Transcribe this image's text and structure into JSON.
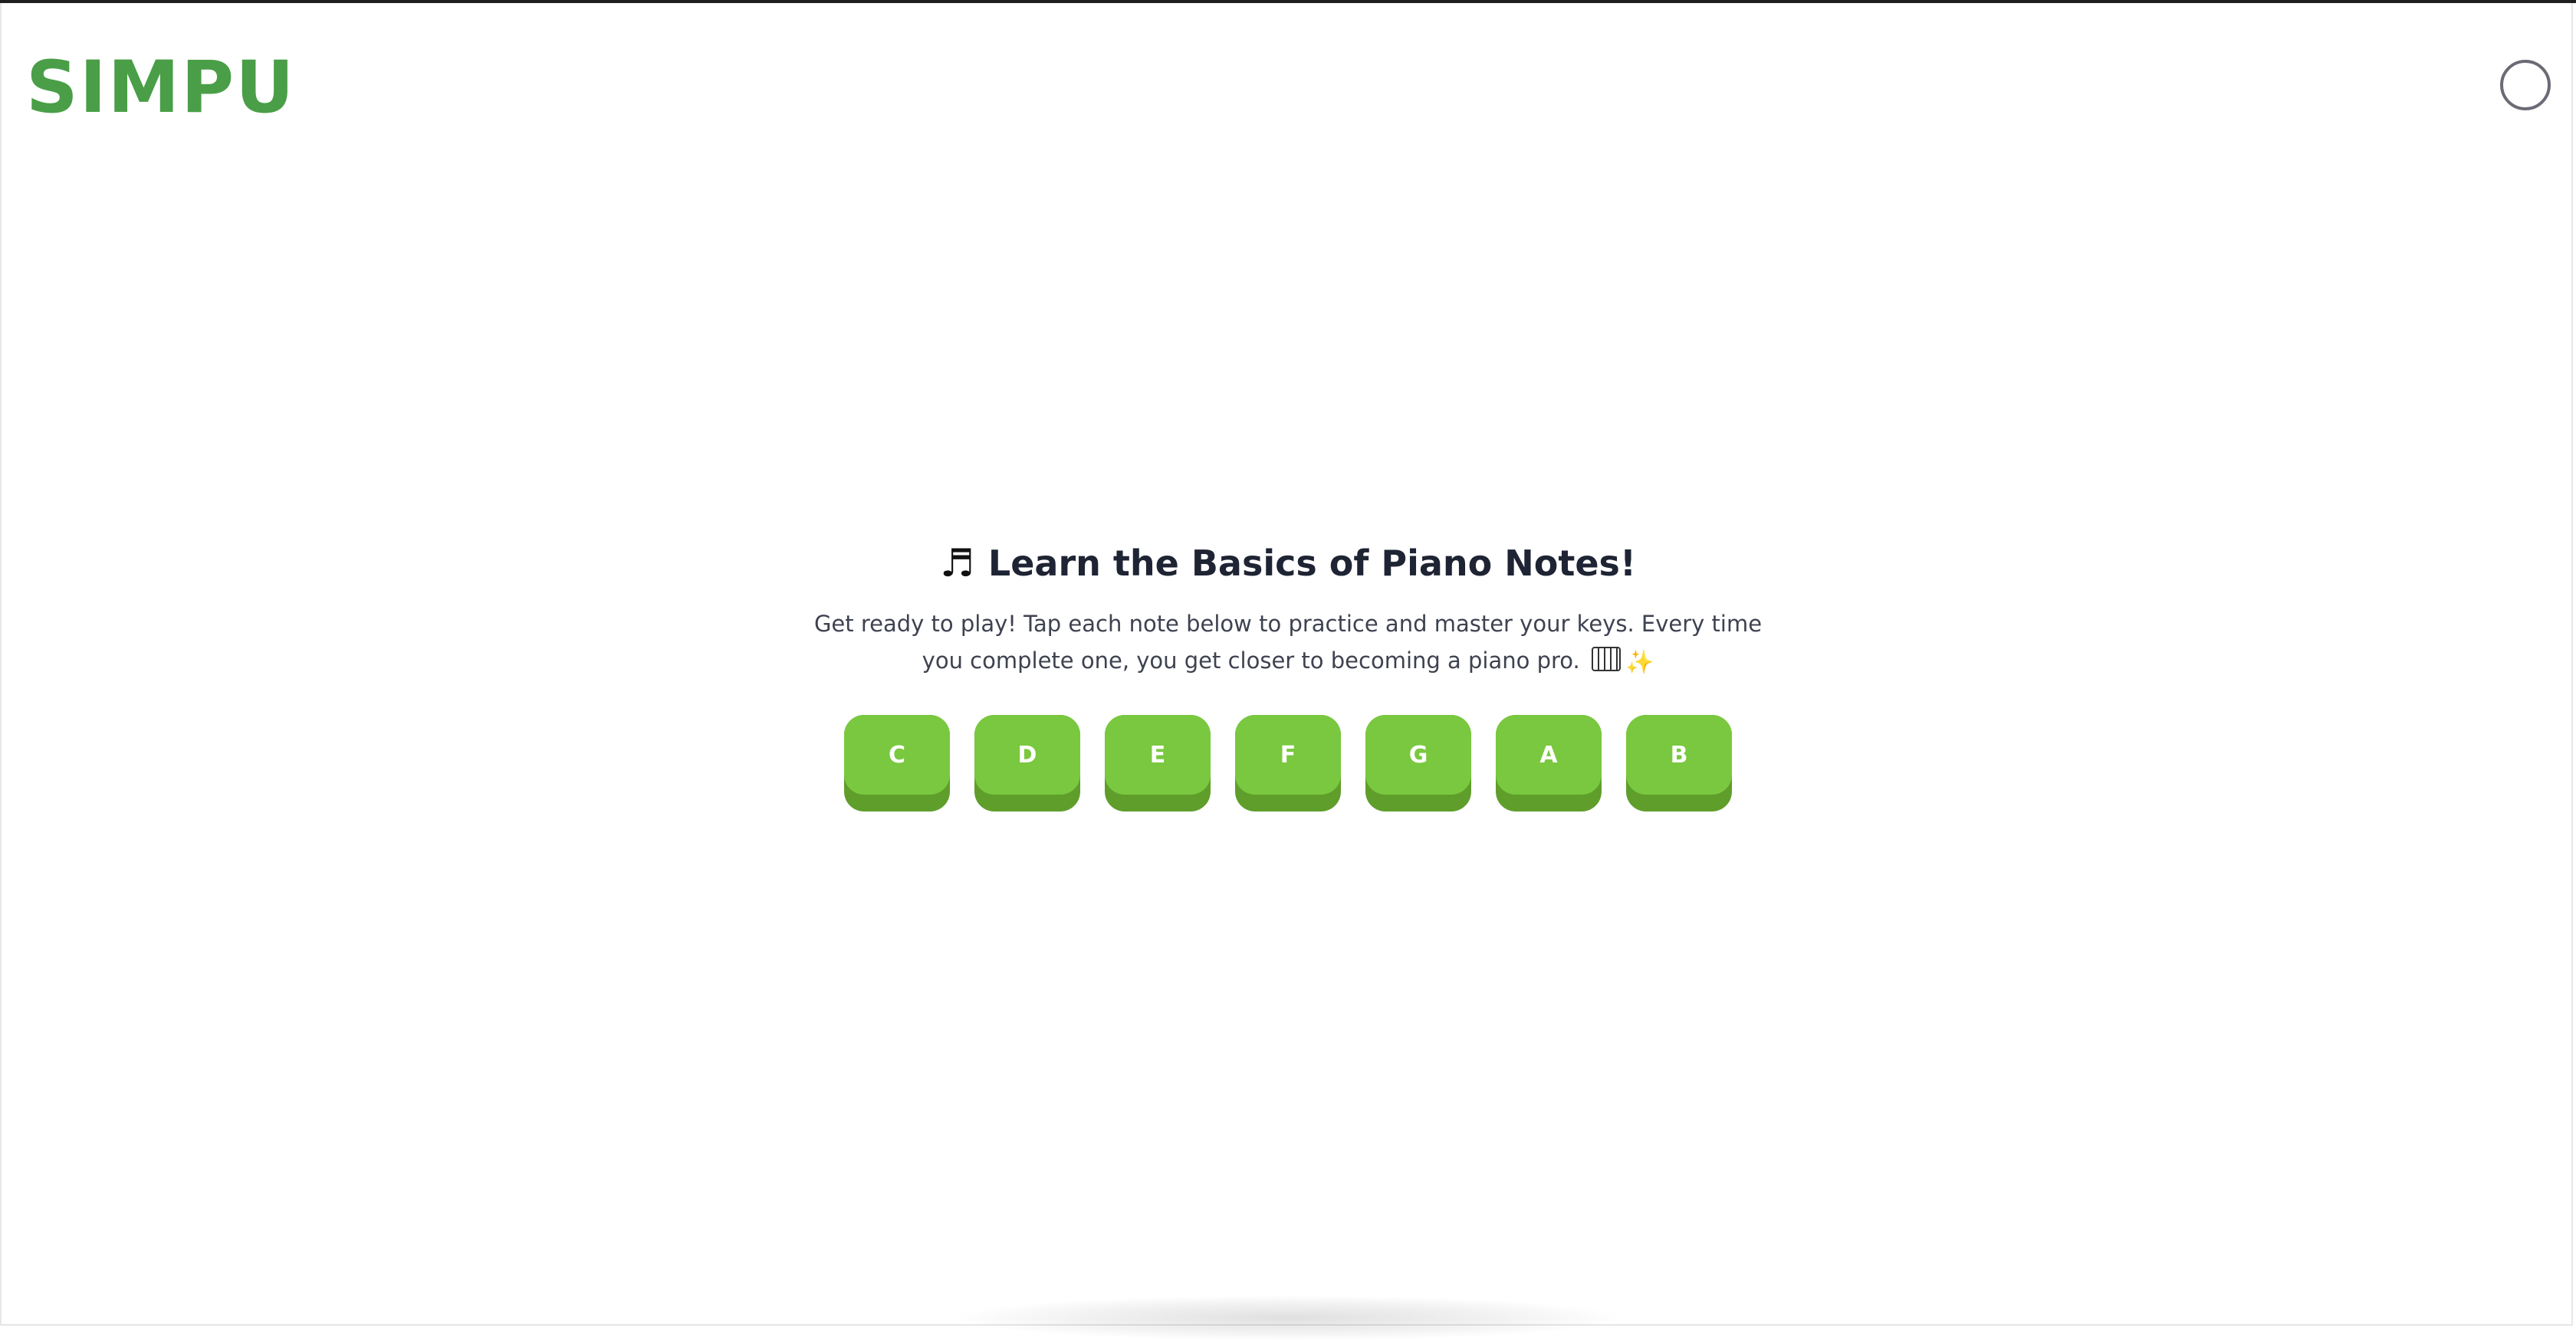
{
  "header": {
    "logo_text": "SIMPU"
  },
  "lesson": {
    "heading_icon": "♬",
    "heading": "Learn the Basics of Piano Notes!",
    "description": "Get ready to play! Tap each note below to practice and master your keys. Every time you complete one, you get closer to becoming a piano pro.",
    "sparkle_emoji": "✨"
  },
  "notes": [
    "C",
    "D",
    "E",
    "F",
    "G",
    "A",
    "B"
  ],
  "colors": {
    "logo": "#4a9e47",
    "key_face": "#79c83f",
    "key_base": "#5f9e2b",
    "heading": "#1e2433",
    "body_text": "#3e4250"
  }
}
